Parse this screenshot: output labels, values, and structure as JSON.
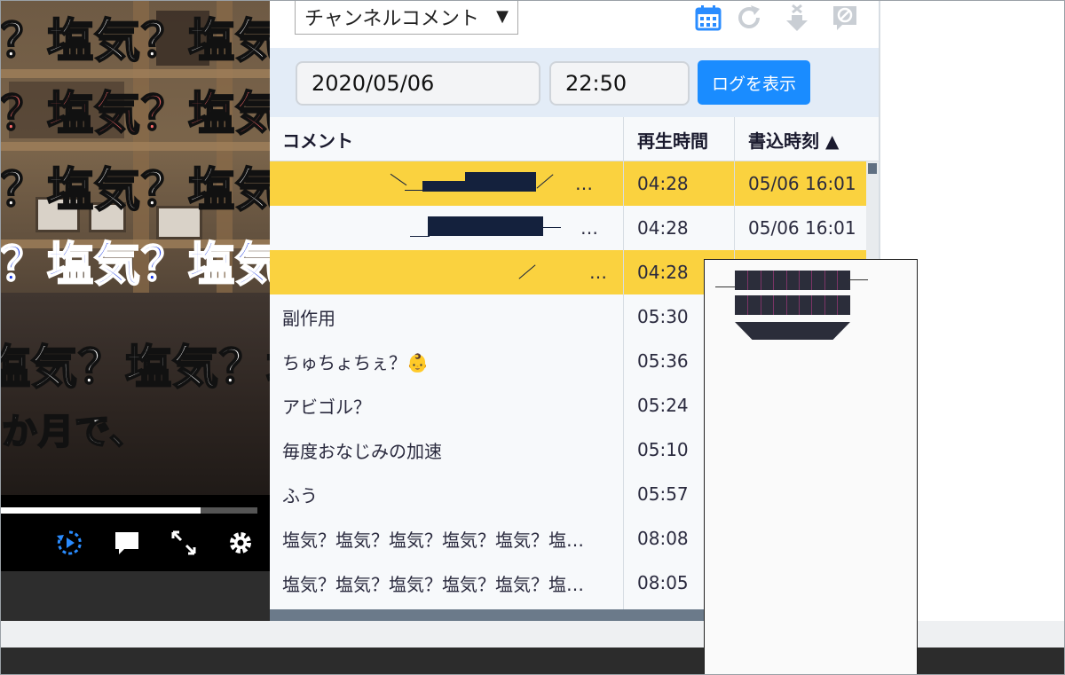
{
  "video": {
    "danmaku_line1": "？塩気？塩気？塩",
    "danmaku_line2": "？塩気？塩気？塩",
    "danmaku_line3": "？塩気？塩気？塩",
    "danmaku_line4": "？塩気？塩気？塩",
    "danmaku_line5": "塩気？塩気？塩気",
    "subtitle": "か月で、",
    "seek_progress": 0.78
  },
  "toolbar": {
    "channel_select": "チャンネルコメント",
    "channel_select_arrow": "▼"
  },
  "datebar": {
    "date_value": "2020/05/06",
    "time_value": "22:50",
    "show_log_label": "ログを表示"
  },
  "table": {
    "headers": {
      "comment": "コメント",
      "playback_time": "再生時間",
      "write_time": "書込時刻 ▲"
    },
    "rows": [
      {
        "comment": "",
        "more": "…",
        "time": "04:28",
        "written": "05/06 16:01",
        "highlight": true
      },
      {
        "comment": "",
        "more": "…",
        "time": "04:28",
        "written": "05/06 16:01",
        "highlight": false
      },
      {
        "comment": "",
        "more": "…",
        "time": "04:28",
        "written": "",
        "highlight": true
      },
      {
        "comment": "副作用",
        "time": "05:30",
        "written": "",
        "highlight": false
      },
      {
        "comment": "ちゅちょちぇ？👶",
        "time": "05:36",
        "written": "",
        "highlight": false
      },
      {
        "comment": "アビゴル？",
        "time": "05:24",
        "written": "",
        "highlight": false
      },
      {
        "comment": "毎度おなじみの加速",
        "time": "05:10",
        "written": "",
        "highlight": false
      },
      {
        "comment": "ふう",
        "time": "05:57",
        "written": "",
        "highlight": false
      },
      {
        "comment": "塩気？塩気？塩気？塩気？塩気？塩…",
        "time": "08:08",
        "written": "",
        "highlight": false
      },
      {
        "comment": "塩気？塩気？塩気？塩気？塩気？塩…",
        "time": "08:05",
        "written": "",
        "highlight": false
      }
    ]
  },
  "colors": {
    "accent_blue": "#1a8cff",
    "highlight_yellow": "#fad23f",
    "header_text": "#1a1a2e"
  },
  "icons": [
    "calendar-icon",
    "refresh-icon",
    "download-close-icon",
    "mute-comment-icon",
    "replay-icon",
    "comment-icon",
    "fullscreen-icon",
    "gear-icon"
  ]
}
